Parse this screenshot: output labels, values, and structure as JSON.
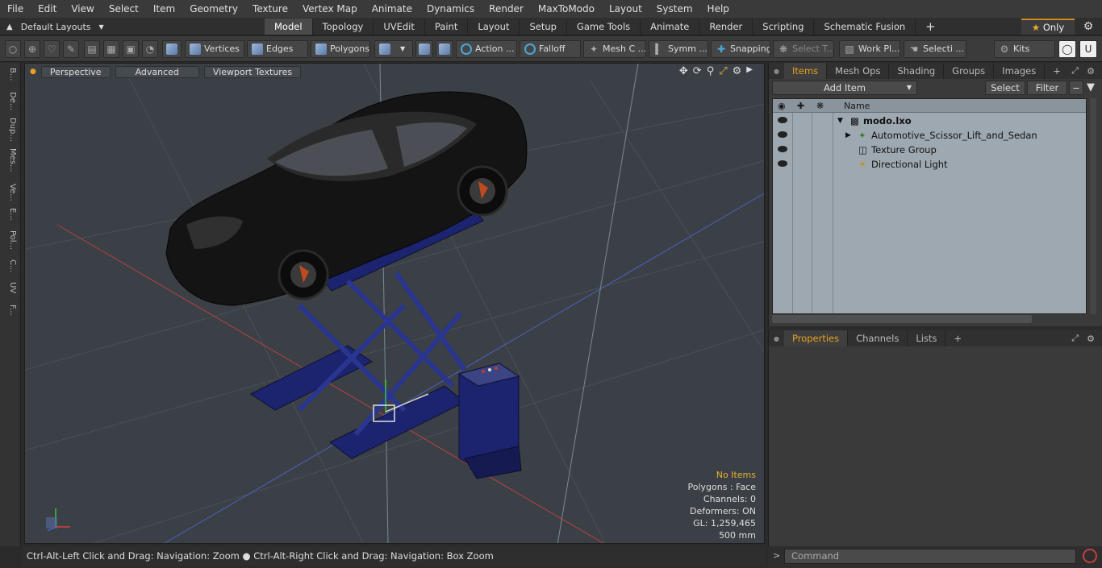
{
  "menu": [
    "File",
    "Edit",
    "View",
    "Select",
    "Item",
    "Geometry",
    "Texture",
    "Vertex Map",
    "Animate",
    "Dynamics",
    "Render",
    "MaxToModo",
    "Layout",
    "System",
    "Help"
  ],
  "layouts": {
    "label": "Default Layouts"
  },
  "tabs": [
    "Model",
    "Topology",
    "UVEdit",
    "Paint",
    "Layout",
    "Setup",
    "Game Tools",
    "Animate",
    "Render",
    "Scripting",
    "Schematic Fusion"
  ],
  "active_tab": "Model",
  "only_label": "Only",
  "toolbar": {
    "vertices": "Vertices",
    "edges": "Edges",
    "polygons": "Polygons",
    "action": "Action ...",
    "falloff": "Falloff",
    "mesh": "Mesh C ...",
    "symm": "Symm ...",
    "snapping": "Snapping",
    "select_t": "Select T...",
    "workpl": "Work Pl...",
    "selecti": "Selecti ...",
    "kits": "Kits"
  },
  "left_rail": [
    "B...",
    "De...",
    "Dup...",
    "Mes...",
    "Ve...",
    "E...",
    "Pol...",
    "C...",
    "UV",
    "F..."
  ],
  "viewport": {
    "perspective": "Perspective",
    "advanced": "Advanced",
    "textures": "Viewport Textures",
    "stats": {
      "no_items": "No Items",
      "polygons": "Polygons : Face",
      "channels": "Channels: 0",
      "deformers": "Deformers: ON",
      "gl": "GL: 1,259,465",
      "scale": "500 mm"
    }
  },
  "status": "Ctrl-Alt-Left Click and Drag: Navigation: Zoom ● Ctrl-Alt-Right Click and Drag: Navigation: Box Zoom",
  "items_panel": {
    "tabs": [
      "Items",
      "Mesh Ops",
      "Shading",
      "Groups",
      "Images"
    ],
    "add_item": "Add Item",
    "select": "Select",
    "filter": "Filter",
    "name_col": "Name",
    "rows": [
      "modo.lxo",
      "Automotive_Scissor_Lift_and_Sedan",
      "Texture Group",
      "Directional Light"
    ]
  },
  "props_panel": {
    "tabs": [
      "Properties",
      "Channels",
      "Lists"
    ]
  },
  "command": {
    "placeholder": "Command"
  },
  "colors": {
    "accent": "#e8a020",
    "viewport_bg": "#3b4046",
    "lift": "#1c2470"
  }
}
